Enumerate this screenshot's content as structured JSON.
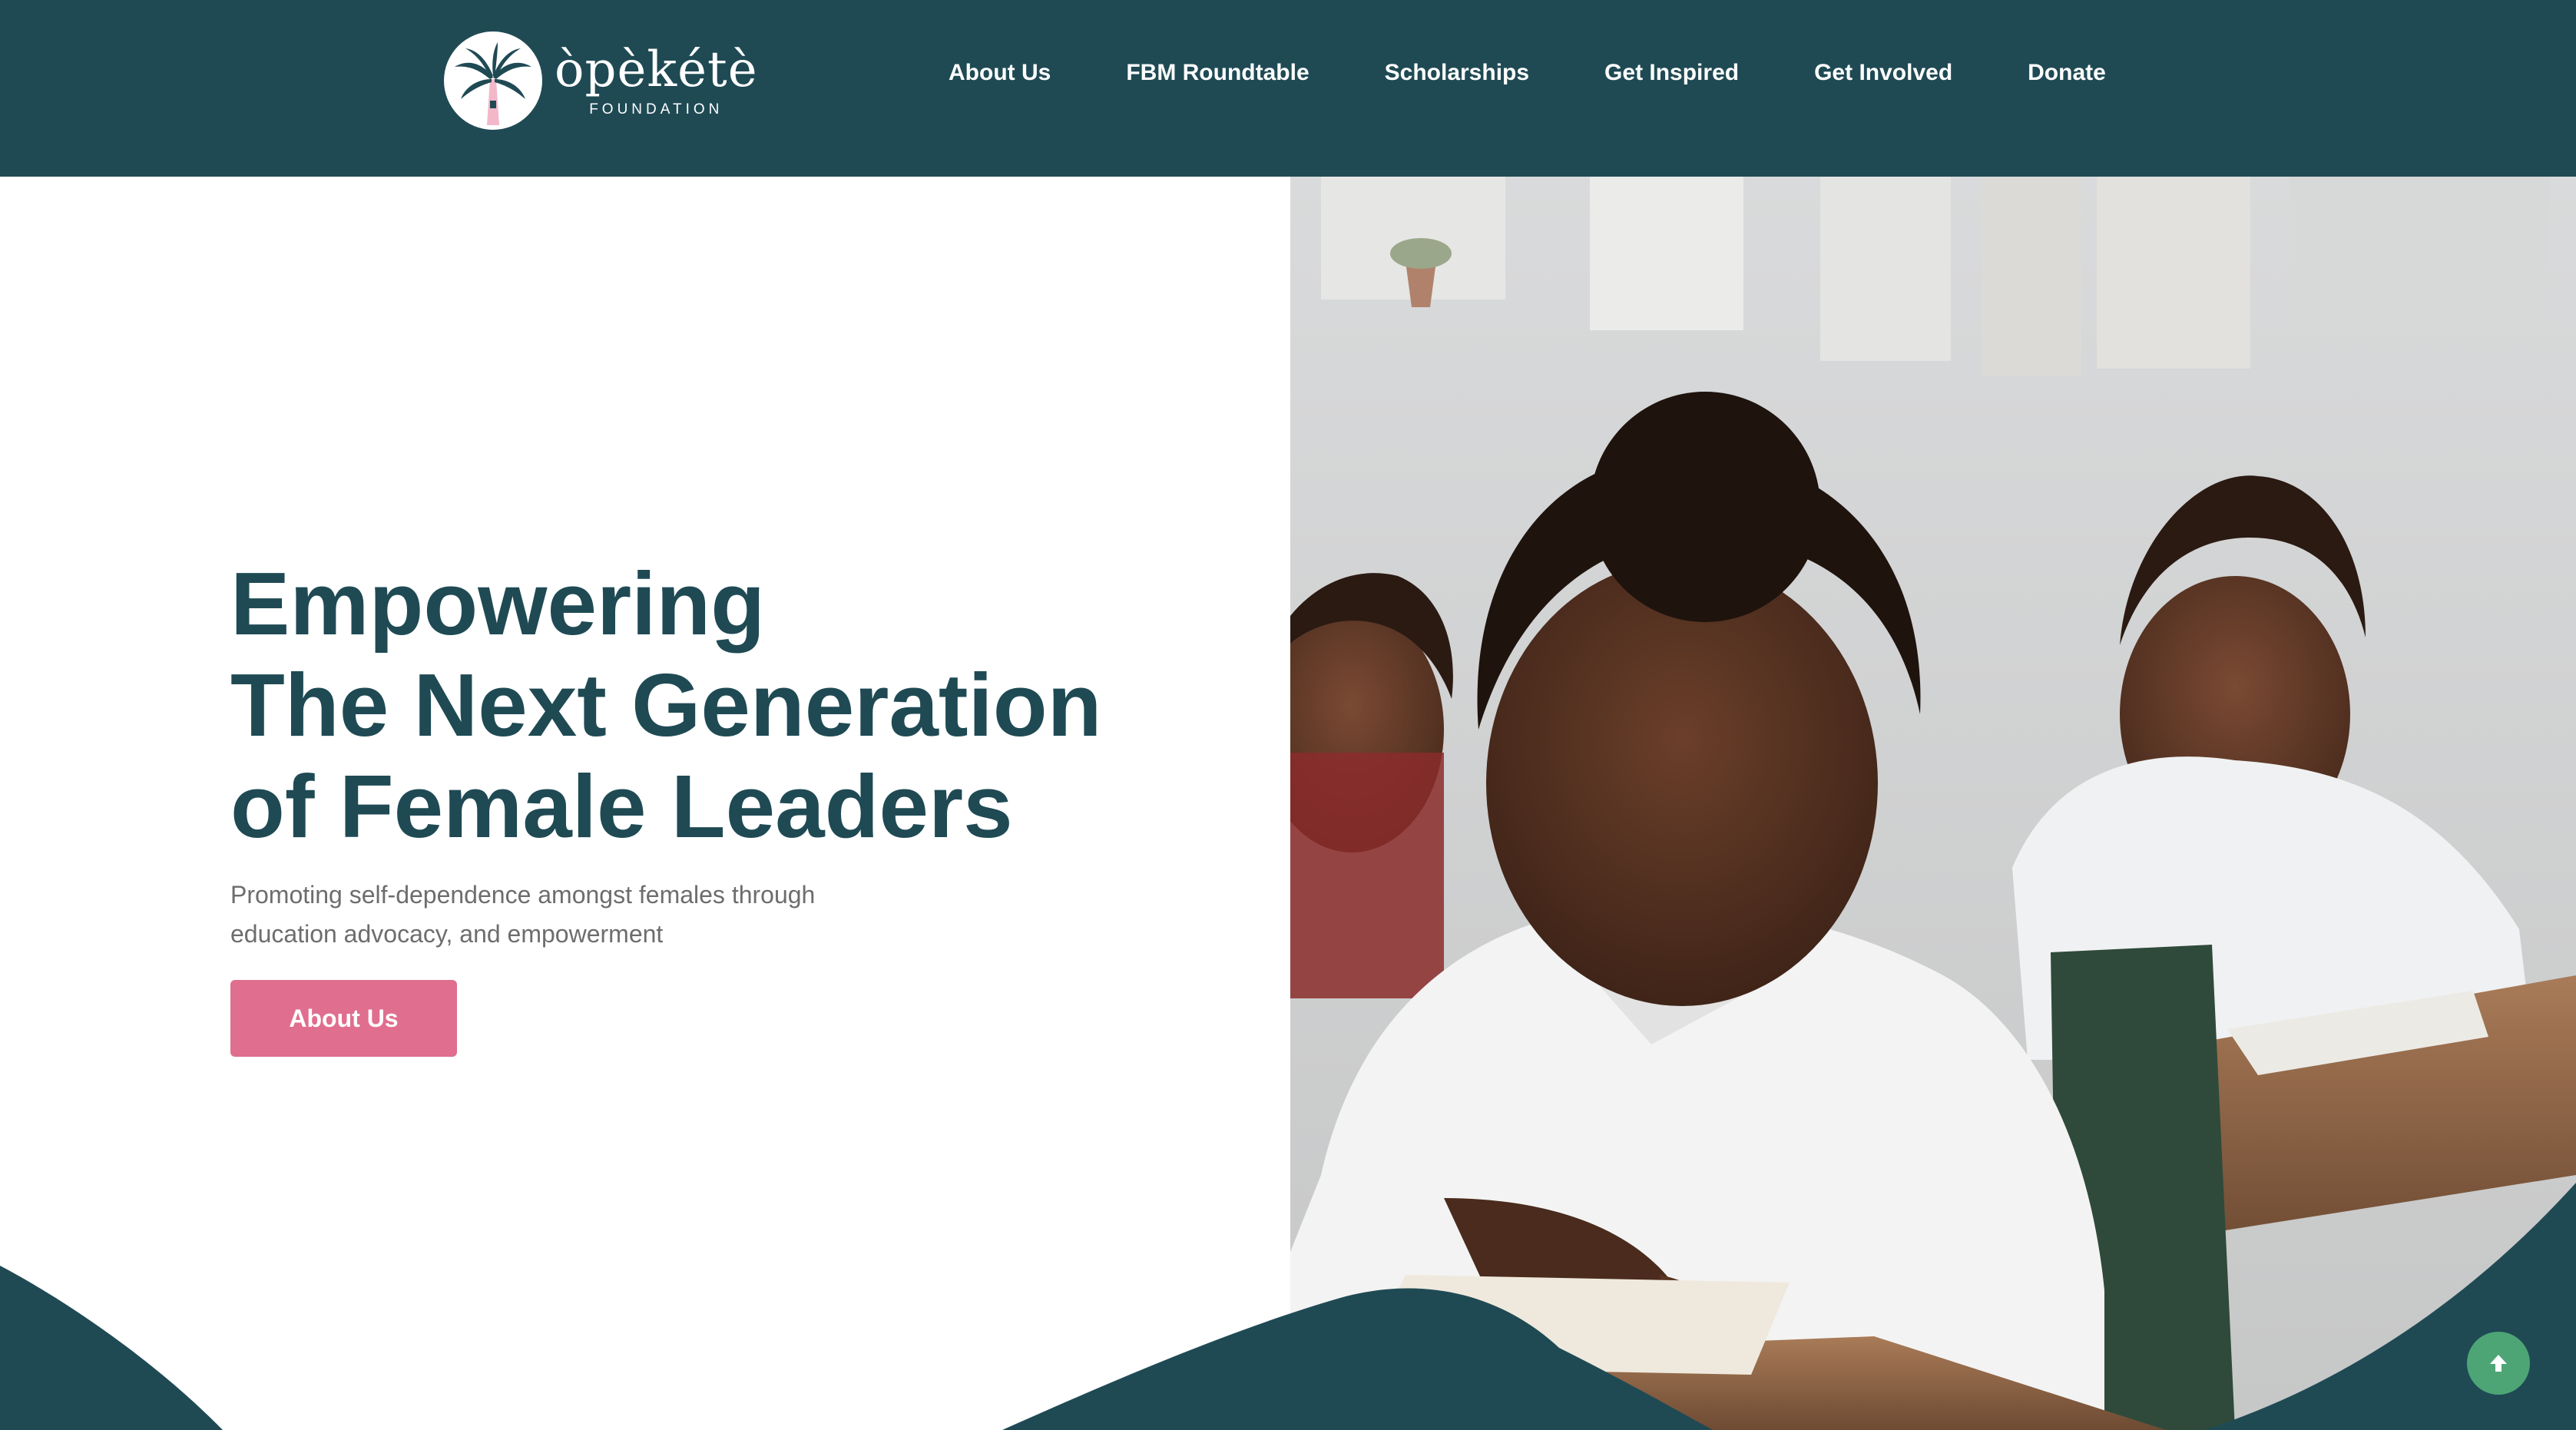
{
  "brand": {
    "name": "òpèkétè",
    "subtitle": "FOUNDATION",
    "primary_color": "#1f4a54",
    "accent_color": "#e06e8f",
    "scroll_top_color": "#4da576"
  },
  "nav": {
    "items": [
      {
        "label": "About Us"
      },
      {
        "label": "FBM Roundtable"
      },
      {
        "label": "Scholarships"
      },
      {
        "label": "Get Inspired"
      },
      {
        "label": "Get Involved"
      },
      {
        "label": "Donate"
      }
    ]
  },
  "hero": {
    "headline_lines": [
      "Empowering",
      "The Next Generation",
      "of Female Leaders"
    ],
    "subtext_lines": [
      "Promoting self-dependence amongst females through",
      "education advocacy, and empowerment"
    ],
    "cta_label": "About Us",
    "image_subject": "girl-reading-in-classroom"
  },
  "scroll_top": {
    "icon": "arrow-up-icon"
  }
}
